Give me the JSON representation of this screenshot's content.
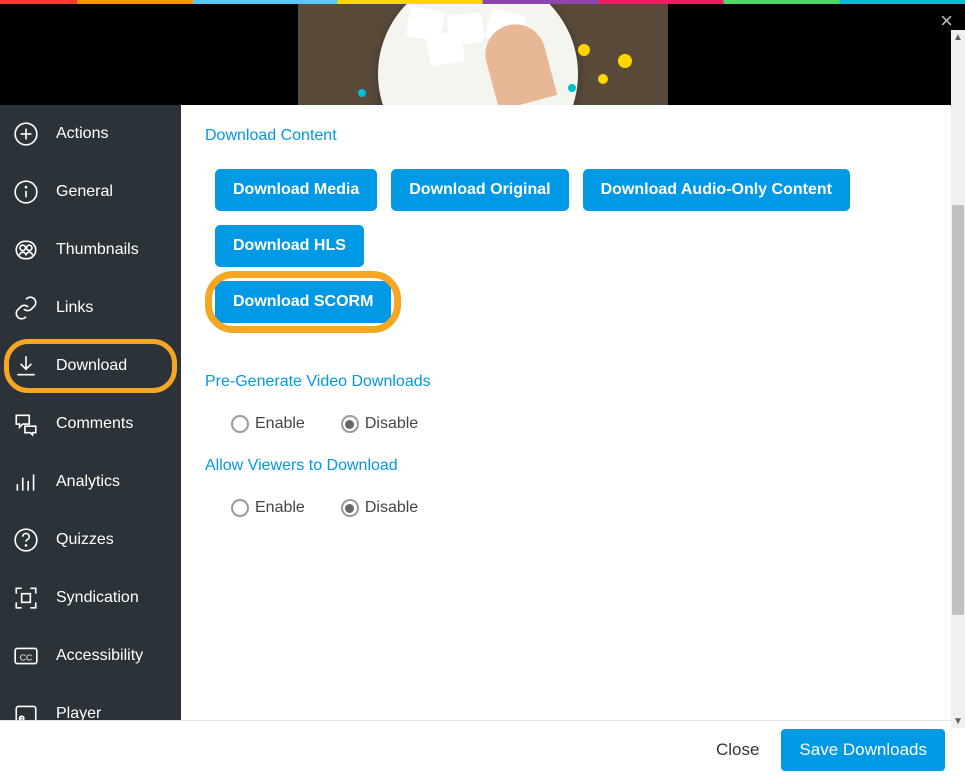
{
  "sidebar": {
    "items": [
      {
        "id": "actions",
        "label": "Actions"
      },
      {
        "id": "general",
        "label": "General"
      },
      {
        "id": "thumbnails",
        "label": "Thumbnails"
      },
      {
        "id": "links",
        "label": "Links"
      },
      {
        "id": "download",
        "label": "Download"
      },
      {
        "id": "comments",
        "label": "Comments"
      },
      {
        "id": "analytics",
        "label": "Analytics"
      },
      {
        "id": "quizzes",
        "label": "Quizzes"
      },
      {
        "id": "syndication",
        "label": "Syndication"
      },
      {
        "id": "accessibility",
        "label": "Accessibility"
      },
      {
        "id": "player",
        "label": "Player"
      }
    ]
  },
  "content": {
    "section1_title": "Download Content",
    "buttons": {
      "media": "Download Media",
      "original": "Download Original",
      "audio": "Download Audio-Only Content",
      "hls": "Download HLS",
      "scorm": "Download SCORM"
    },
    "section2_title": "Pre-Generate Video Downloads",
    "section3_title": "Allow Viewers to Download",
    "radio": {
      "enable": "Enable",
      "disable": "Disable"
    }
  },
  "footer": {
    "close": "Close",
    "save": "Save Downloads"
  }
}
